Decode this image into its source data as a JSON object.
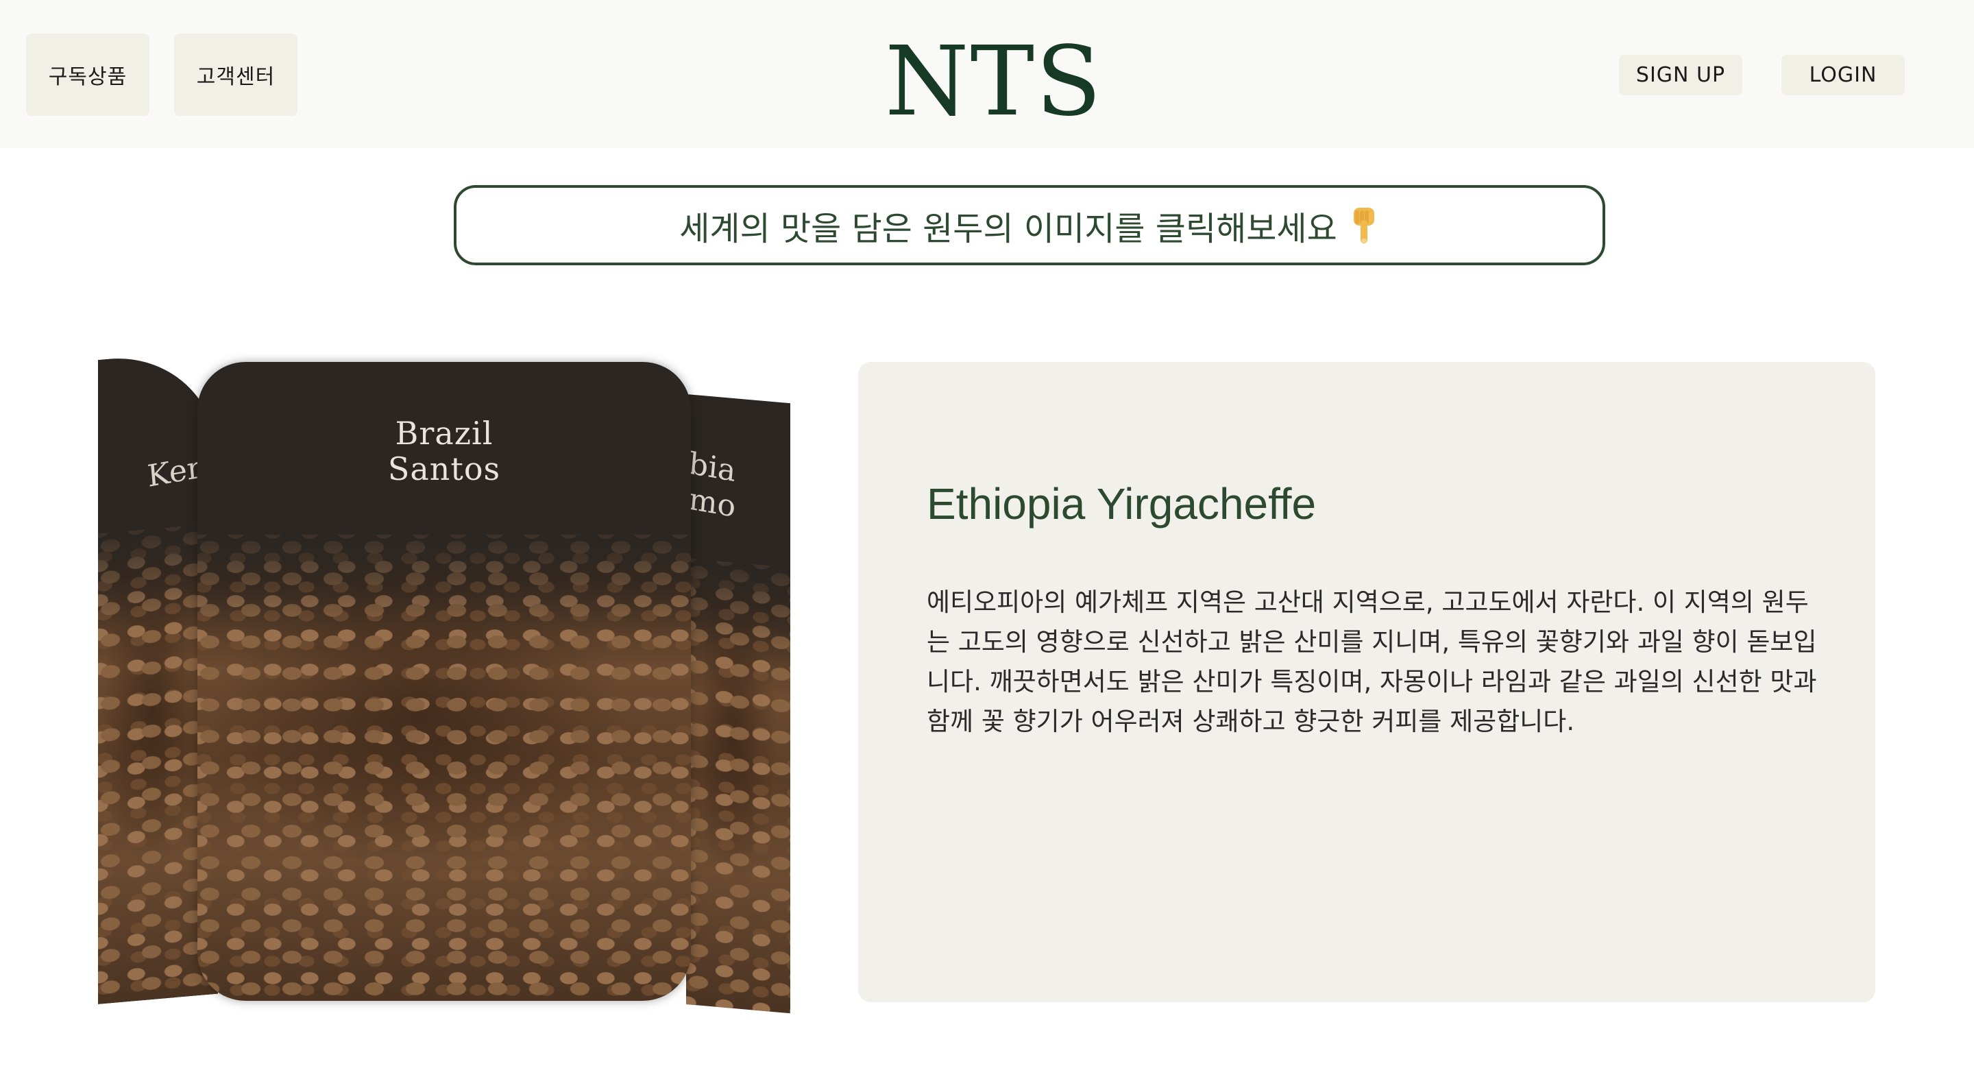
{
  "header": {
    "nav": [
      {
        "label": "구독상품"
      },
      {
        "label": "고객센터"
      }
    ],
    "logo": "NTS",
    "signup_label": "SIGN UP",
    "login_label": "LOGIN"
  },
  "banner": {
    "text": "세계의 맛을 담은 원두의 이미지를 클릭해보세요",
    "icon": "pointing-down-hand-icon"
  },
  "cards": {
    "left": {
      "label": "Ker"
    },
    "center": {
      "line1": "Brazil",
      "line2": "Santos"
    },
    "right": {
      "line1": "bia",
      "line2": "mo"
    }
  },
  "info": {
    "title": "Ethiopia Yirgacheffe",
    "description": "에티오피아의 예가체프 지역은 고산대 지역으로, 고고도에서 자란다. 이 지역의 원두는 고도의 영향으로 신선하고 밝은 산미를 지니며, 특유의 꽃향기와 과일 향이 돋보입니다. 깨끗하면서도 밝은 산미가 특징이며, 자몽이나 라임과 같은 과일의 신선한 맛과 함께 꽃 향기가 어우러져 상쾌하고 향긋한 커피를 제공합니다."
  },
  "colors": {
    "brand_green": "#2d4a30",
    "logo_green": "#173a26",
    "nav_bg": "#f0f0e7",
    "panel_bg": "#f1f0eb"
  }
}
